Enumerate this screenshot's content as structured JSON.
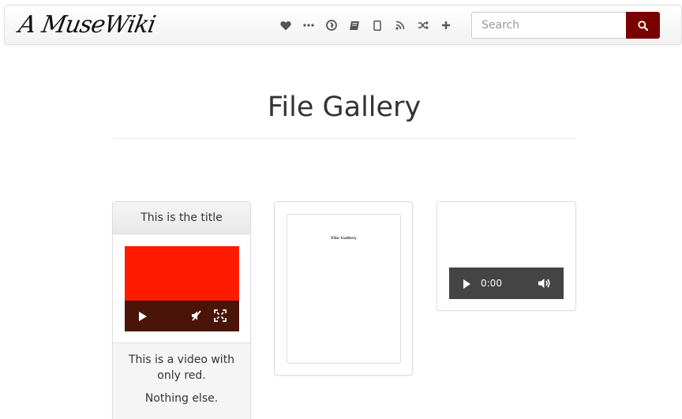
{
  "header": {
    "logo_text": "A MuseWiki",
    "nav_icons": [
      {
        "name": "heart-icon"
      },
      {
        "name": "more-icon"
      },
      {
        "name": "globe-icon"
      },
      {
        "name": "book-icon"
      },
      {
        "name": "tablet-icon"
      },
      {
        "name": "rss-icon"
      },
      {
        "name": "random-icon"
      },
      {
        "name": "plus-icon"
      }
    ],
    "search": {
      "placeholder": "Search",
      "value": "",
      "button_icon": "search-icon"
    },
    "colors": {
      "accent": "#7a0000"
    }
  },
  "main": {
    "title": "File Gallery",
    "gallery": [
      {
        "type": "video",
        "title": "This is the title",
        "description": [
          "This is a video with only red.",
          "Nothing else."
        ],
        "video_color": "#ff1a00"
      },
      {
        "type": "pdf",
        "thumbnail_title": "File Gallery"
      },
      {
        "type": "audio",
        "time": "0:00"
      }
    ]
  }
}
